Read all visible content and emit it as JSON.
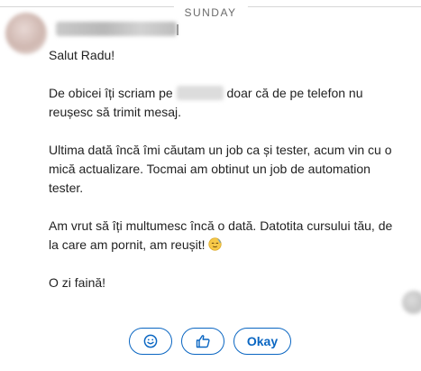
{
  "divider": {
    "day_label": "SUNDAY"
  },
  "message": {
    "paragraphs": [
      "Salut Radu!",
      "De obicei îți scriam pe",
      "doar că de pe telefon nu reușesc să trimit mesaj.",
      "Ultima dată încă îmi căutam un job ca și tester, acum vin cu o mică actualizare. Tocmai am obtinut un job de automation tester.",
      "Am vrut să îți multumesc încă o dată. Datotita cursului tău, de la care am pornit, am reușit!",
      "O zi faină!"
    ]
  },
  "quick_replies": {
    "smile_icon": "smile-emoji-icon",
    "like_icon": "thumbs-up-icon",
    "okay_label": "Okay"
  },
  "colors": {
    "accent": "#0a66c2",
    "divider": "#d6d6d6",
    "text": "#222222"
  }
}
